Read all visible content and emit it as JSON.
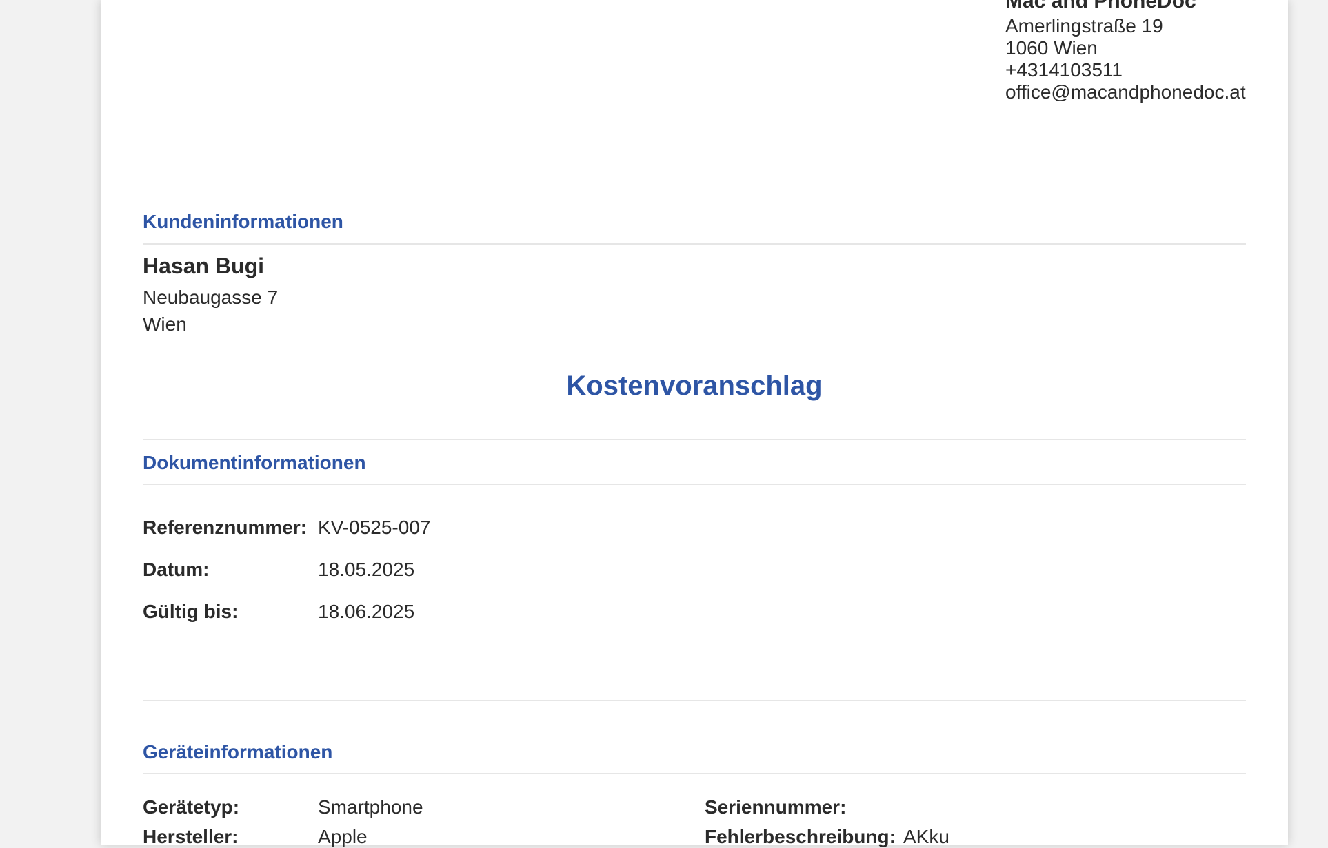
{
  "company": {
    "name": "Mac and PhoneDoc",
    "street": "Amerlingstraße 19",
    "city": "1060 Wien",
    "phone": "+4314103511",
    "email": "office@macandphonedoc.at"
  },
  "customer_section": {
    "title": "Kundeninformationen",
    "name": "Hasan Bugi",
    "street": "Neubaugasse 7",
    "city": "Wien"
  },
  "document": {
    "title": "Kostenvoranschlag"
  },
  "doc_info": {
    "title": "Dokumentinformationen",
    "ref_label": "Referenznummer:",
    "ref_value": "KV-0525-007",
    "date_label": "Datum:",
    "date_value": "18.05.2025",
    "valid_label": "Gültig bis:",
    "valid_value": "18.06.2025"
  },
  "device_info": {
    "title": "Geräteinformationen",
    "type_label": "Gerätetyp:",
    "type_value": "Smartphone",
    "manufacturer_label": "Hersteller:",
    "manufacturer_value": "Apple",
    "serial_label": "Seriennummer:",
    "serial_value": "",
    "fault_label": "Fehlerbeschreibung:",
    "fault_value": "AKku"
  },
  "colors": {
    "accent": "#2e55a5",
    "text": "#2b2b2b",
    "rule": "#e6e6e6"
  }
}
